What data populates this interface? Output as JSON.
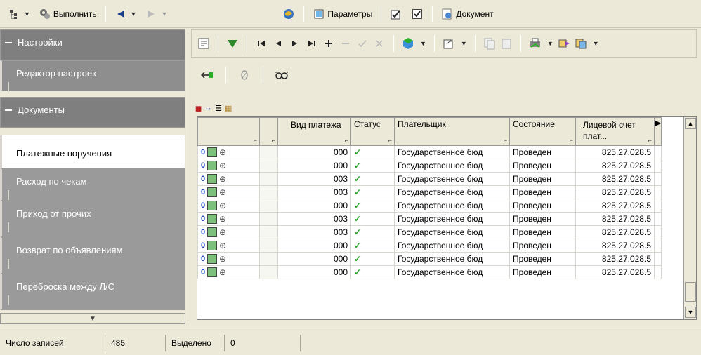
{
  "toolbar": {
    "execute_label": "Выполнить",
    "params_label": "Параметры",
    "document_label": "Документ"
  },
  "nav": {
    "settings_header": "Настройки",
    "settings_editor": "Редактор настроек",
    "documents_header": "Документы",
    "items": [
      "Платежные поручения",
      "Расход по чекам",
      "Приход от прочих",
      "Возврат по объявлениям",
      "Переброска между Л/С"
    ]
  },
  "grid": {
    "headers": {
      "type": "Вид платежа",
      "status": "Статус",
      "payer": "Плательщик",
      "state": "Состояние",
      "account": "Лицевой счет плат..."
    },
    "rows": [
      {
        "type": "000",
        "payer": "Государственное бюд",
        "state": "Проведен",
        "account": "825.27.028.5"
      },
      {
        "type": "000",
        "payer": "Государственное бюд",
        "state": "Проведен",
        "account": "825.27.028.5"
      },
      {
        "type": "003",
        "payer": "Государственное бюд",
        "state": "Проведен",
        "account": "825.27.028.5"
      },
      {
        "type": "003",
        "payer": "Государственное бюд",
        "state": "Проведен",
        "account": "825.27.028.5"
      },
      {
        "type": "000",
        "payer": "Государственное бюд",
        "state": "Проведен",
        "account": "825.27.028.5"
      },
      {
        "type": "003",
        "payer": "Государственное бюд",
        "state": "Проведен",
        "account": "825.27.028.5"
      },
      {
        "type": "003",
        "payer": "Государственное бюд",
        "state": "Проведен",
        "account": "825.27.028.5"
      },
      {
        "type": "000",
        "payer": "Государственное бюд",
        "state": "Проведен",
        "account": "825.27.028.5"
      },
      {
        "type": "000",
        "payer": "Государственное бюд",
        "state": "Проведен",
        "account": "825.27.028.5"
      },
      {
        "type": "000",
        "payer": "Государственное бюд",
        "state": "Проведен",
        "account": "825.27.028.5"
      }
    ]
  },
  "status": {
    "records_label": "Число записей",
    "records_value": "485",
    "selected_label": "Выделено",
    "selected_value": "0"
  }
}
